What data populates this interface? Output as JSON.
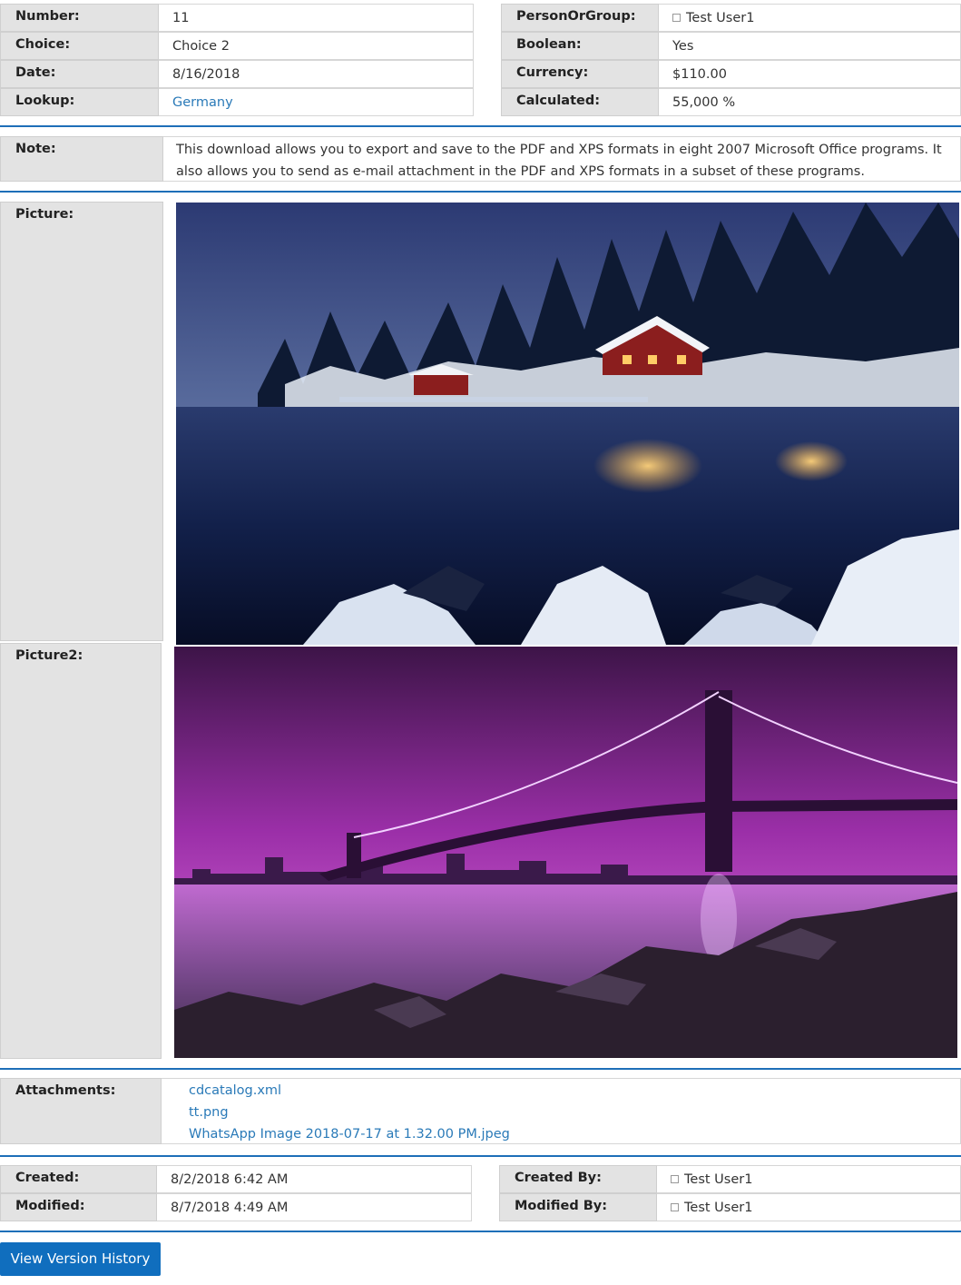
{
  "fields_left": [
    {
      "label": "Number:",
      "value": "11"
    },
    {
      "label": "Choice:",
      "value": "Choice 2"
    },
    {
      "label": "Date:",
      "value": "8/16/2018"
    },
    {
      "label": "Lookup:",
      "value": "Germany"
    }
  ],
  "fields_right": [
    {
      "label": "PersonOrGroup:",
      "value": "Test User1"
    },
    {
      "label": "Boolean:",
      "value": "Yes"
    },
    {
      "label": "Currency:",
      "value": "$110.00"
    },
    {
      "label": "Calculated:",
      "value": "55,000 %"
    }
  ],
  "note": {
    "label": "Note:",
    "text": "This download allows you to export and save to the PDF and XPS formats in eight 2007 Microsoft Office programs. It also allows you to send as e-mail attachment in the PDF and XPS formats in a subset of these programs."
  },
  "picture": {
    "label": "Picture:"
  },
  "picture2": {
    "label": "Picture2:"
  },
  "attachments": {
    "label": "Attachments:",
    "files": [
      "cdcatalog.xml",
      "tt.png",
      "WhatsApp Image 2018-07-17 at 1.32.00 PM.jpeg"
    ]
  },
  "meta_left": [
    {
      "label": "Created:",
      "value": "8/2/2018 6:42 AM"
    },
    {
      "label": "Modified:",
      "value": "8/7/2018 4:49 AM"
    }
  ],
  "meta_right": [
    {
      "label": "Created By:",
      "value": "Test User1"
    },
    {
      "label": "Modified By:",
      "value": "Test User1"
    }
  ],
  "version_history_button": "View Version History",
  "colors": {
    "accent": "#106ebe",
    "link": "#2a7ab8",
    "label_bg": "#e3e3e3",
    "separator": "#1e6fb8"
  }
}
